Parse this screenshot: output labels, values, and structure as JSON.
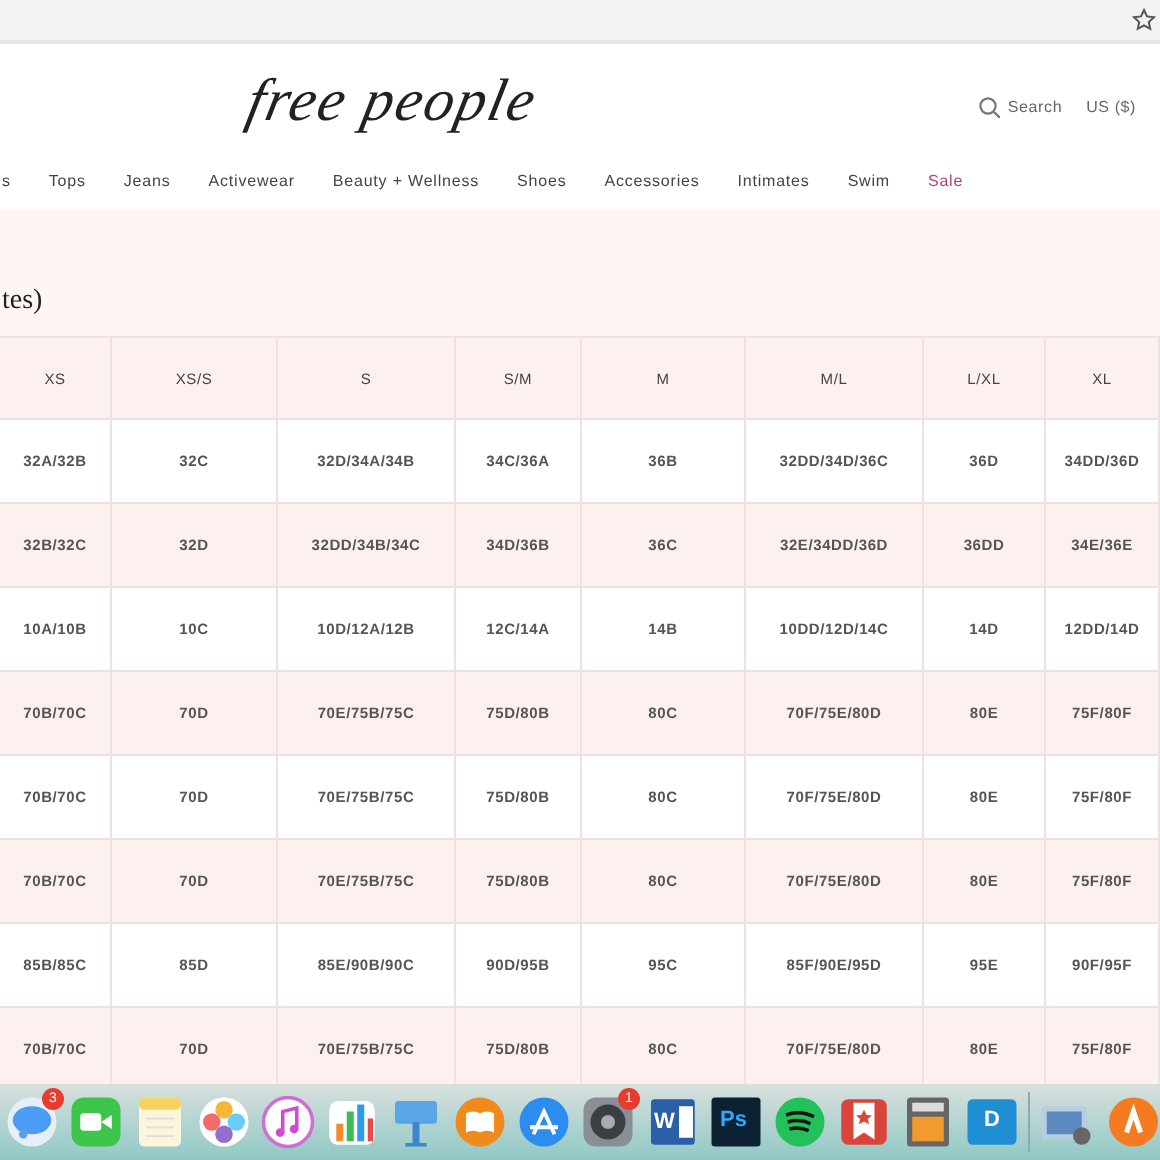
{
  "header": {
    "logo": "free people",
    "search": "Search",
    "currency": "US ($)"
  },
  "nav": [
    {
      "label": "s",
      "kind": "normal"
    },
    {
      "label": "Tops",
      "kind": "normal"
    },
    {
      "label": "Jeans",
      "kind": "normal"
    },
    {
      "label": "Activewear",
      "kind": "normal"
    },
    {
      "label": "Beauty + Wellness",
      "kind": "normal"
    },
    {
      "label": "Shoes",
      "kind": "normal"
    },
    {
      "label": "Accessories",
      "kind": "normal"
    },
    {
      "label": "Intimates",
      "kind": "normal"
    },
    {
      "label": "Swim",
      "kind": "normal"
    },
    {
      "label": "Sale",
      "kind": "sale"
    }
  ],
  "heading": "tes)",
  "table": {
    "columns": [
      "XS",
      "XS/S",
      "S",
      "S/M",
      "M",
      "M/L",
      "L/XL",
      "XL"
    ],
    "rows": [
      [
        "32A/32B",
        "32C",
        "32D/34A/34B",
        "34C/36A",
        "36B",
        "32DD/34D/36C",
        "36D",
        "34DD/36D"
      ],
      [
        "32B/32C",
        "32D",
        "32DD/34B/34C",
        "34D/36B",
        "36C",
        "32E/34DD/36D",
        "36DD",
        "34E/36E"
      ],
      [
        "10A/10B",
        "10C",
        "10D/12A/12B",
        "12C/14A",
        "14B",
        "10DD/12D/14C",
        "14D",
        "12DD/14D"
      ],
      [
        "70B/70C",
        "70D",
        "70E/75B/75C",
        "75D/80B",
        "80C",
        "70F/75E/80D",
        "80E",
        "75F/80F"
      ],
      [
        "70B/70C",
        "70D",
        "70E/75B/75C",
        "75D/80B",
        "80C",
        "70F/75E/80D",
        "80E",
        "75F/80F"
      ],
      [
        "70B/70C",
        "70D",
        "70E/75B/75C",
        "75D/80B",
        "80C",
        "70F/75E/80D",
        "80E",
        "75F/80F"
      ],
      [
        "85B/85C",
        "85D",
        "85E/90B/90C",
        "90D/95B",
        "95C",
        "85F/90E/95D",
        "95E",
        "90F/95F"
      ],
      [
        "70B/70C",
        "70D",
        "70E/75B/75C",
        "75D/80B",
        "80C",
        "70F/75E/80D",
        "80E",
        "75F/80F"
      ]
    ]
  },
  "dock": [
    {
      "kind": "messages",
      "badge": "3"
    },
    {
      "kind": "facetime"
    },
    {
      "kind": "notes"
    },
    {
      "kind": "photos"
    },
    {
      "kind": "music"
    },
    {
      "kind": "numbers"
    },
    {
      "kind": "keynote"
    },
    {
      "kind": "books"
    },
    {
      "kind": "appstore"
    },
    {
      "kind": "preferences",
      "badge": "1"
    },
    {
      "kind": "word",
      "label": "W"
    },
    {
      "kind": "photoshop",
      "label": "Ps"
    },
    {
      "kind": "spotify"
    },
    {
      "kind": "wunderlist"
    },
    {
      "kind": "calculator"
    },
    {
      "kind": "dashlane",
      "label": "D"
    },
    {
      "kind": "separator"
    },
    {
      "kind": "preview"
    },
    {
      "kind": "avast"
    }
  ]
}
